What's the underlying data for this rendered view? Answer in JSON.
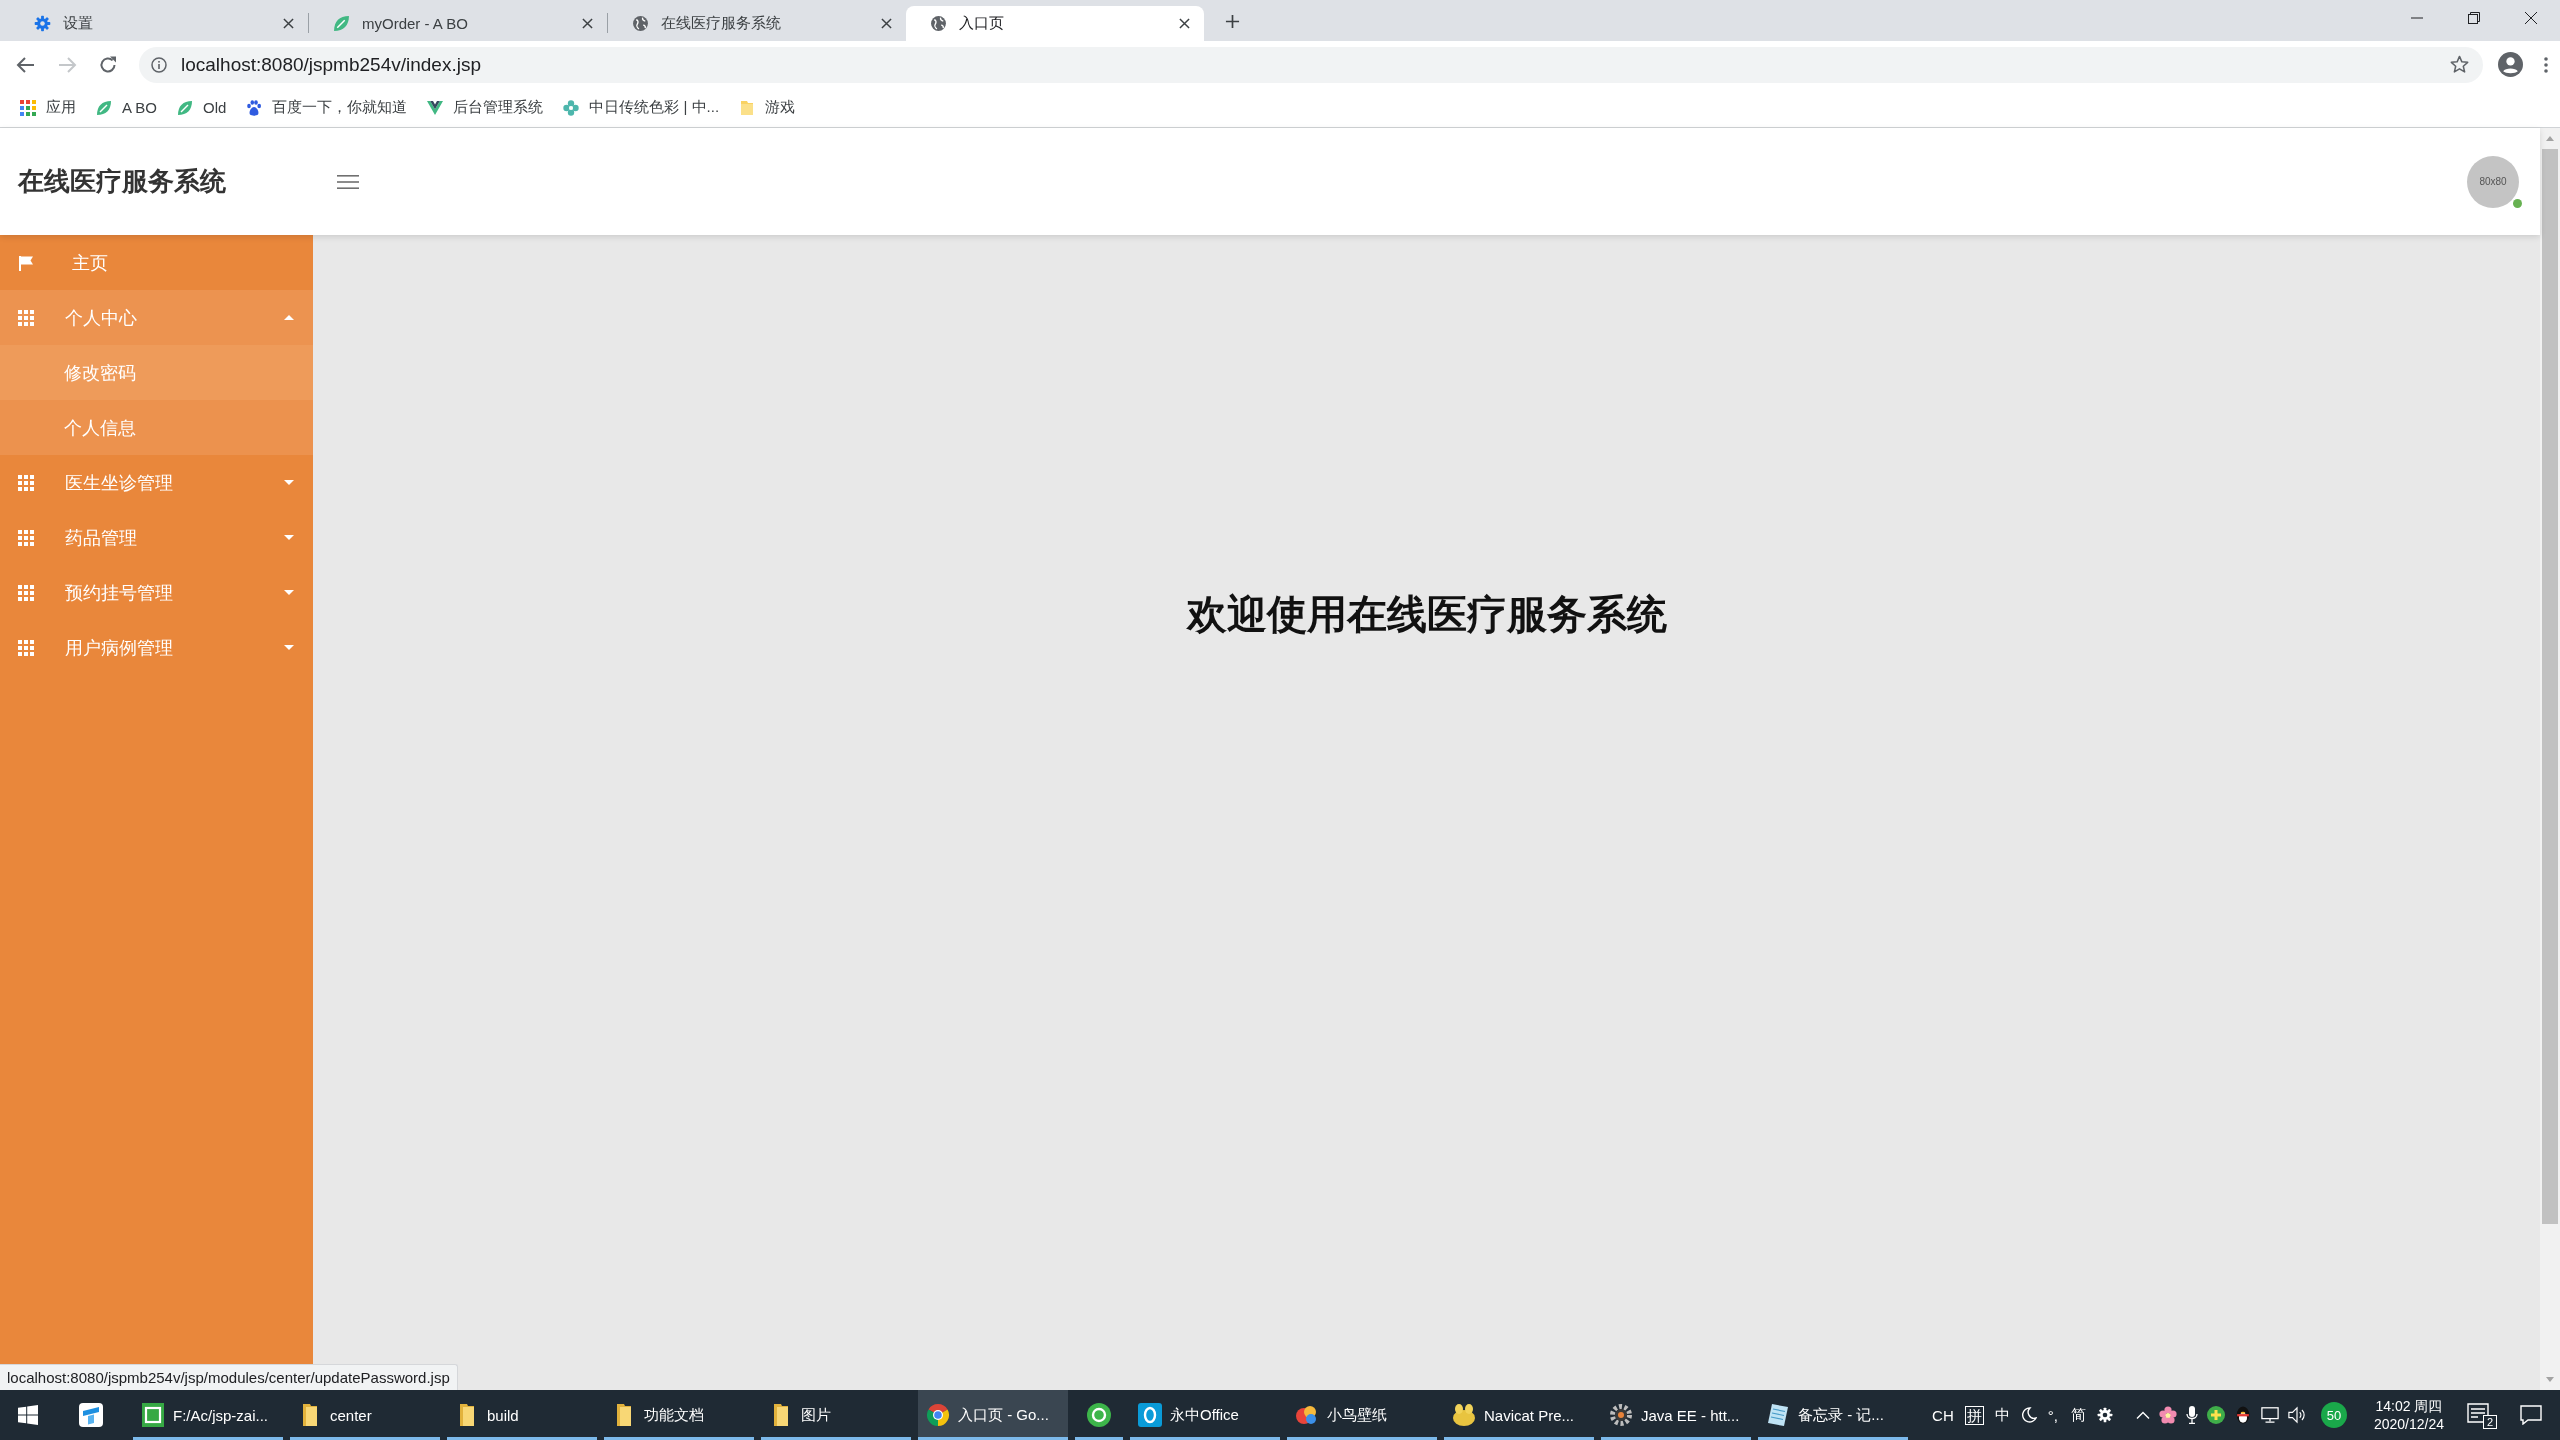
{
  "browser": {
    "tabs": [
      {
        "title": "设置",
        "kind": "settings",
        "selected": false
      },
      {
        "title": "myOrder - A BO",
        "kind": "leaf",
        "selected": false
      },
      {
        "title": "在线医疗服务系统",
        "kind": "globe",
        "selected": false
      },
      {
        "title": "入口页",
        "kind": "globe",
        "selected": true
      }
    ],
    "toolbar": {
      "url": "localhost:8080/jspmb254v/index.jsp",
      "forward_disabled": true
    },
    "bookmarks": [
      {
        "label": "应用",
        "kind": "apps"
      },
      {
        "label": "A BO",
        "kind": "leaf"
      },
      {
        "label": "Old",
        "kind": "leaf"
      },
      {
        "label": "百度一下，你就知道",
        "kind": "paw"
      },
      {
        "label": "后台管理系统",
        "kind": "vue"
      },
      {
        "label": "中日传统色彩 | 中...",
        "kind": "flower"
      },
      {
        "label": "游戏",
        "kind": "folder"
      }
    ]
  },
  "header": {
    "title": "在线医疗服务系统",
    "avatar_text": "80x80",
    "online": true
  },
  "sidebar": {
    "items": [
      {
        "label": "主页",
        "kind": "link"
      },
      {
        "label": "个人中心",
        "kind": "group",
        "expanded": true,
        "children": [
          {
            "label": "修改密码",
            "hovered": true
          },
          {
            "label": "个人信息",
            "hovered": false
          }
        ]
      },
      {
        "label": "医生坐诊管理",
        "kind": "group",
        "expanded": false
      },
      {
        "label": "药品管理",
        "kind": "group",
        "expanded": false
      },
      {
        "label": "预约挂号管理",
        "kind": "group",
        "expanded": false
      },
      {
        "label": "用户病例管理",
        "kind": "group",
        "expanded": false
      }
    ]
  },
  "main": {
    "welcome": "欢迎使用在线医疗服务系统"
  },
  "status_bubble": "localhost:8080/jspmb254v/jsp/modules/center/updatePassword.jsp",
  "taskbar": {
    "apps": [
      {
        "kind": "tile",
        "running": false,
        "selected": false
      },
      {
        "label": "F:/Ac/jsp-zai...",
        "kind": "hbuilder",
        "running": true,
        "selected": false
      },
      {
        "label": "center",
        "kind": "folder",
        "running": true,
        "selected": false
      },
      {
        "label": "build",
        "kind": "folder",
        "running": true,
        "selected": false
      },
      {
        "label": "功能文档",
        "kind": "folder",
        "running": true,
        "selected": false
      },
      {
        "label": "图片",
        "kind": "folder",
        "running": true,
        "selected": false
      },
      {
        "label": "入口页 - Go...",
        "kind": "chrome",
        "running": true,
        "selected": true
      },
      {
        "kind": "ering",
        "running": true,
        "selected": false
      },
      {
        "label": "永中Office",
        "kind": "office",
        "running": true,
        "selected": false
      },
      {
        "label": "小鸟壁纸",
        "kind": "bird",
        "running": true,
        "selected": false
      },
      {
        "label": "Navicat Pre...",
        "kind": "navicat",
        "running": true,
        "selected": false
      },
      {
        "label": "Java EE - htt...",
        "kind": "eclipse",
        "running": true,
        "selected": false
      },
      {
        "label": "备忘录 - 记...",
        "kind": "notepad",
        "running": true,
        "selected": false
      }
    ],
    "tray": {
      "ime": [
        {
          "kind": "text",
          "label": "CH"
        },
        {
          "kind": "boxed",
          "label": "拼"
        },
        {
          "kind": "text",
          "label": "中"
        },
        {
          "kind": "moon"
        },
        {
          "kind": "text",
          "label": "°,"
        },
        {
          "kind": "text",
          "label": "简"
        },
        {
          "kind": "gear"
        }
      ],
      "score": "50",
      "time": "14:02 周四",
      "date": "2020/12/24",
      "notifications": "2"
    }
  }
}
